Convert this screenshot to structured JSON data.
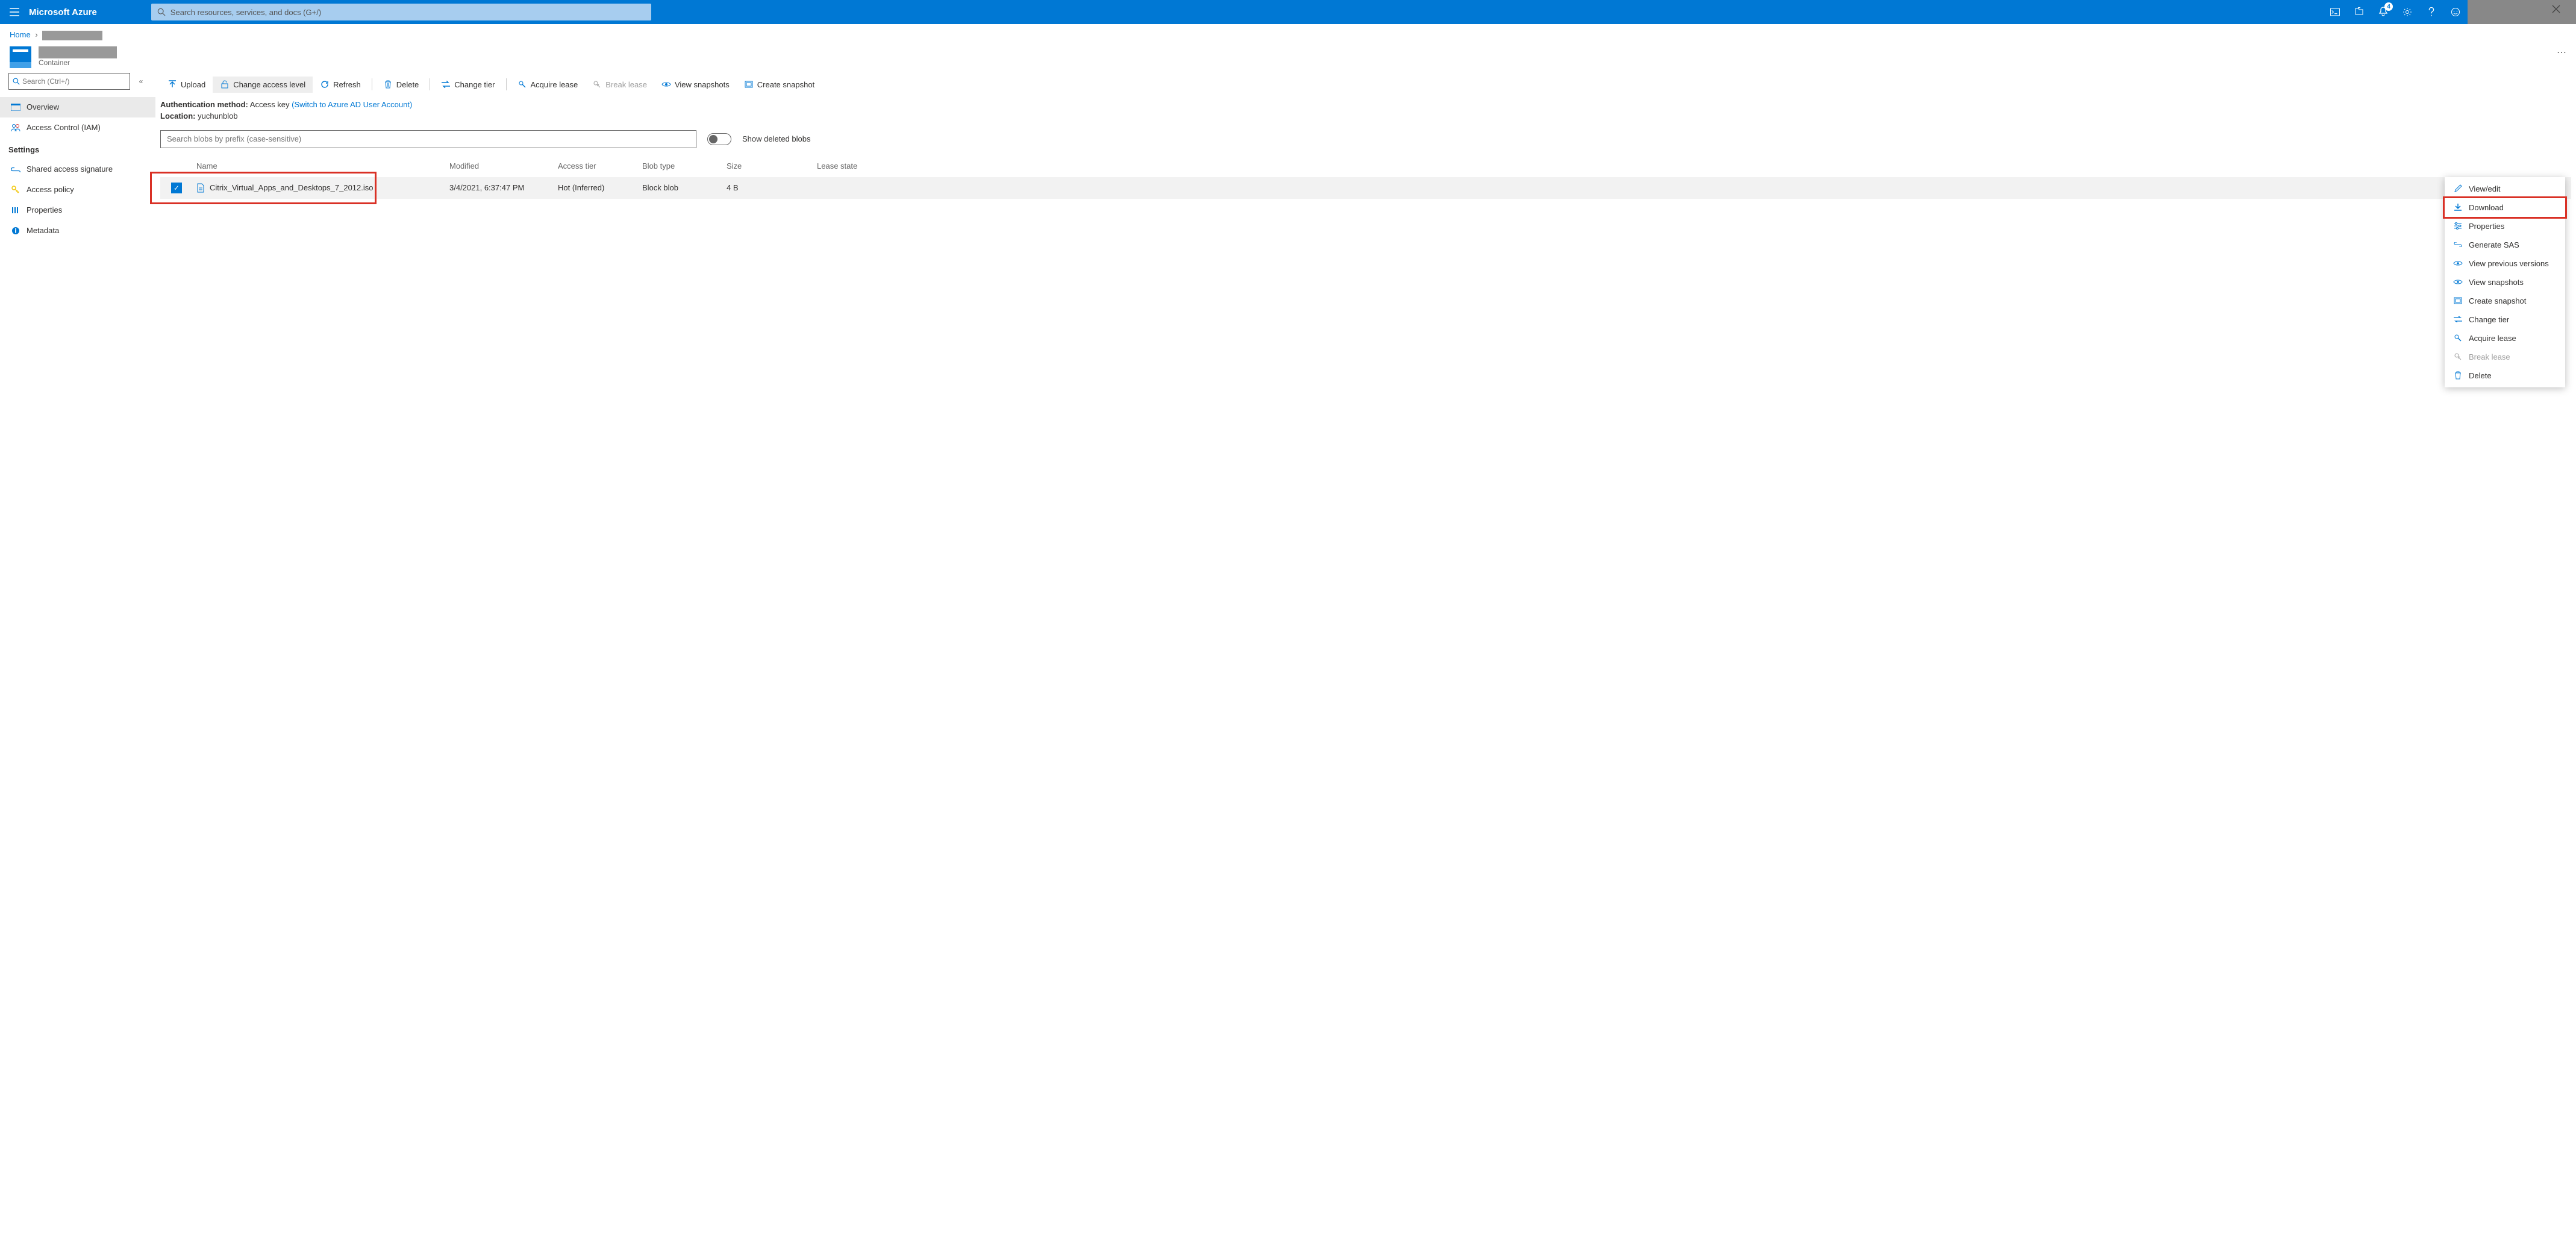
{
  "brand": "Microsoft Azure",
  "search_placeholder": "Search resources, services, and docs (G+/)",
  "notification_count": "4",
  "breadcrumb": {
    "home": "Home"
  },
  "header": {
    "subtitle": "Container"
  },
  "sidebar": {
    "search_placeholder": "Search (Ctrl+/)",
    "overview": "Overview",
    "access_control": "Access Control (IAM)",
    "settings_header": "Settings",
    "shared_sig": "Shared access signature",
    "access_policy": "Access policy",
    "properties": "Properties",
    "metadata": "Metadata"
  },
  "toolbar": {
    "upload": "Upload",
    "change_access": "Change access level",
    "refresh": "Refresh",
    "delete": "Delete",
    "change_tier": "Change tier",
    "acquire_lease": "Acquire lease",
    "break_lease": "Break lease",
    "view_snapshots": "View snapshots",
    "create_snapshot": "Create snapshot"
  },
  "info": {
    "auth_label": "Authentication method:",
    "auth_value": "Access key",
    "auth_switch": "(Switch to Azure AD User Account)",
    "location_label": "Location:",
    "location_value": "yuchunblob"
  },
  "filter": {
    "blob_search_placeholder": "Search blobs by prefix (case-sensitive)",
    "show_deleted": "Show deleted blobs"
  },
  "columns": {
    "name": "Name",
    "modified": "Modified",
    "access_tier": "Access tier",
    "blob_type": "Blob type",
    "size": "Size",
    "lease_state": "Lease state"
  },
  "rows": [
    {
      "name": "Citrix_Virtual_Apps_and_Desktops_7_2012.iso",
      "modified": "3/4/2021, 6:37:47 PM",
      "access_tier": "Hot (Inferred)",
      "blob_type": "Block blob",
      "size": "4 B",
      "lease_state": ""
    }
  ],
  "context_menu": {
    "view_edit": "View/edit",
    "download": "Download",
    "properties": "Properties",
    "generate_sas": "Generate SAS",
    "view_previous": "View previous versions",
    "view_snapshots": "View snapshots",
    "create_snapshot": "Create snapshot",
    "change_tier": "Change tier",
    "acquire_lease": "Acquire lease",
    "break_lease": "Break lease",
    "delete": "Delete"
  }
}
